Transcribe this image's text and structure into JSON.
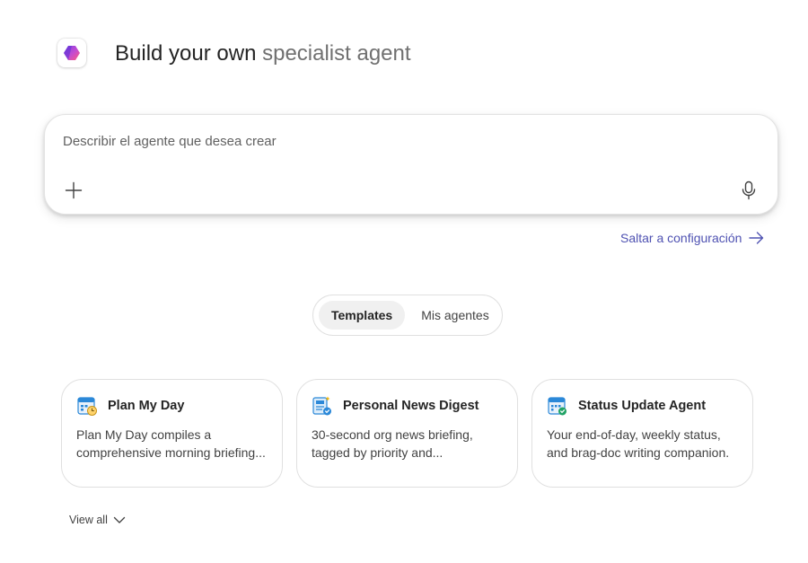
{
  "header": {
    "title_strong": "Build your own",
    "title_light": "specialist agent",
    "logo_icon": "copilot-logo-icon"
  },
  "composer": {
    "placeholder": "Describir el agente que desea crear",
    "value": "",
    "add_icon": "plus-icon",
    "mic_icon": "microphone-icon"
  },
  "skip_link": {
    "label": "Saltar a configuración",
    "icon": "arrow-right-icon"
  },
  "tabs": [
    {
      "label": "Templates",
      "selected": true
    },
    {
      "label": "Mis agentes",
      "selected": false
    }
  ],
  "templates": [
    {
      "title": "Plan My Day",
      "description": "Plan My Day compiles a comprehensive morning briefing...",
      "icon": "calendar-clock-icon"
    },
    {
      "title": "Personal News Digest",
      "description": "30-second org news briefing, tagged by priority and...",
      "icon": "news-document-icon"
    },
    {
      "title": "Status Update Agent",
      "description": "Your end-of-day, weekly status, and brag-doc writing companion.",
      "icon": "calendar-status-icon"
    }
  ],
  "view_all": {
    "label": "View all",
    "icon": "chevron-down-icon"
  },
  "colors": {
    "accent_link": "#4f52b2",
    "text_primary": "#242424",
    "text_secondary": "#707070"
  }
}
